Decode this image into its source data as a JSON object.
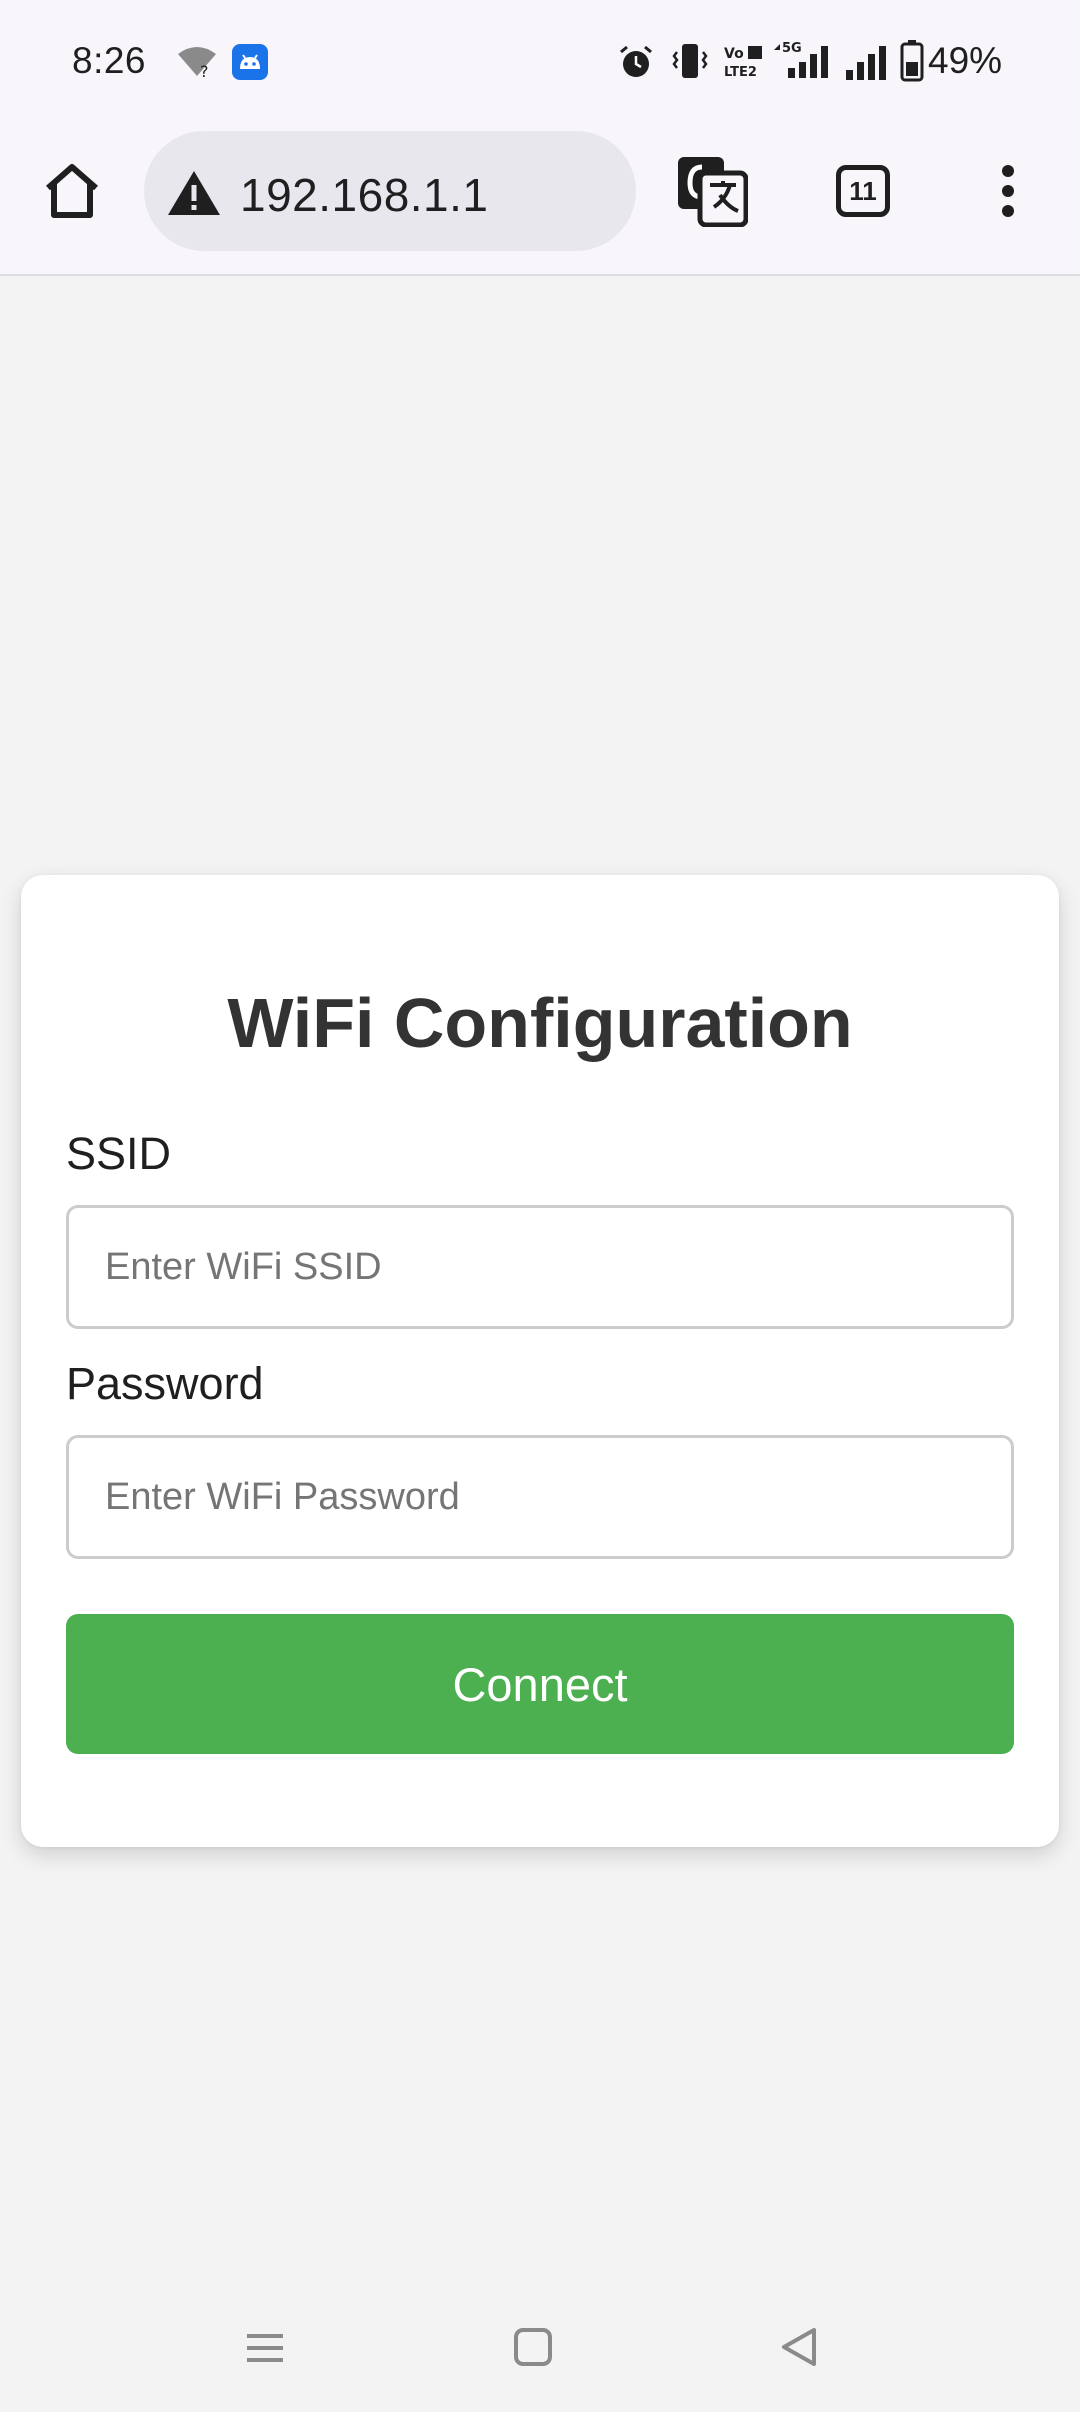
{
  "status_bar": {
    "time": "8:26",
    "battery_percent": "49%",
    "icons": [
      "wifi-question-icon",
      "android-app-icon",
      "alarm-icon",
      "vibrate-icon",
      "volte-icon",
      "signal-5g-icon",
      "signal-icon",
      "battery-icon"
    ]
  },
  "browser": {
    "url": "192.168.1.1",
    "security_icon": "warning-icon",
    "tab_count": "11",
    "buttons": [
      "home-icon",
      "translate-icon",
      "tabs-counter",
      "more-vert-icon"
    ]
  },
  "form": {
    "title": "WiFi Configuration",
    "ssid_label": "SSID",
    "ssid_placeholder": "Enter WiFi SSID",
    "ssid_value": "",
    "password_label": "Password",
    "password_placeholder": "Enter WiFi Password",
    "password_value": "",
    "connect_label": "Connect"
  },
  "colors": {
    "accent": "#4caf50",
    "page_background": "#f3f3f3",
    "chrome_background": "#f8f6fb",
    "url_pill": "#e9e7ee"
  },
  "nav_bar": {
    "buttons": [
      "recents-icon",
      "home-square-icon",
      "back-triangle-icon"
    ]
  }
}
